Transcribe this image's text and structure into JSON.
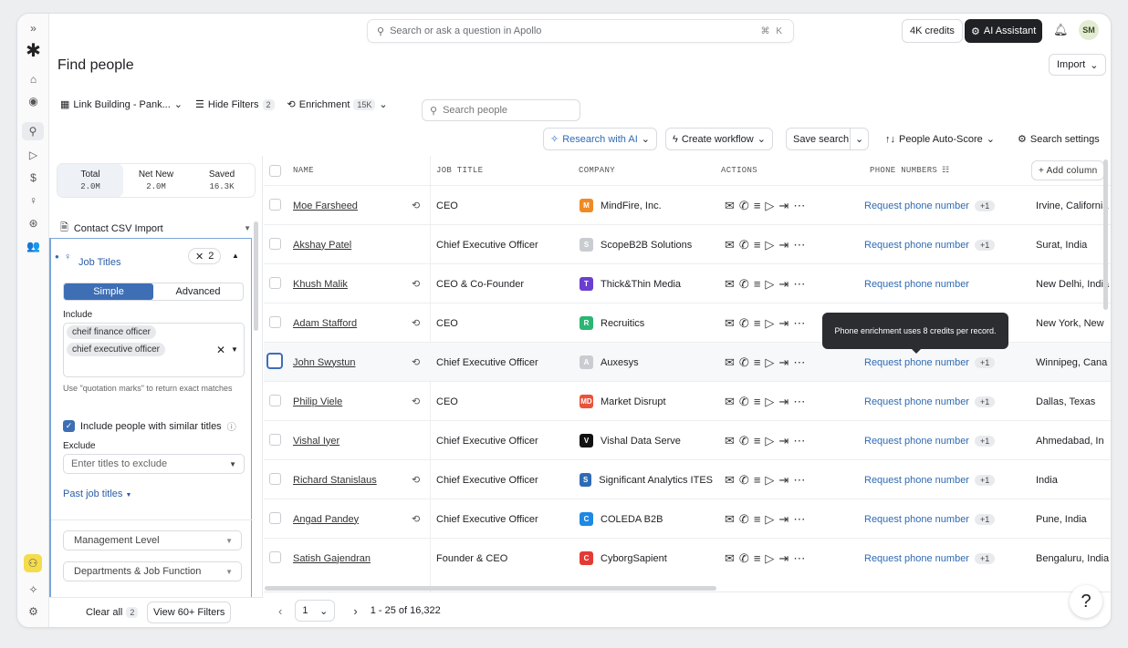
{
  "topbar": {
    "search_placeholder": "Search or ask a question in Apollo",
    "shortcut": "⌘ K",
    "credits": "4K credits",
    "ai_assistant": "AI Assistant",
    "avatar_initials": "SM"
  },
  "page": {
    "title": "Find people",
    "import_label": "Import"
  },
  "filters": {
    "list_name": "Link Building - Pank...",
    "hide_filters": "Hide Filters",
    "hide_filters_count": "2",
    "enrichment": "Enrichment",
    "enrichment_count": "15K",
    "search_placeholder": "Search people"
  },
  "toolbar": {
    "research": "Research with AI",
    "create_workflow": "Create workflow",
    "save_search": "Save search",
    "auto_score": "People Auto-Score",
    "search_settings": "Search settings"
  },
  "stats": [
    {
      "label": "Total",
      "value": "2.0M"
    },
    {
      "label": "Net New",
      "value": "2.0M"
    },
    {
      "label": "Saved",
      "value": "16.3K"
    }
  ],
  "sidebar": {
    "csv_import": "Contact CSV Import",
    "job_titles": "Job Titles",
    "job_titles_count": "2",
    "simple": "Simple",
    "advanced": "Advanced",
    "include": "Include",
    "chips": [
      "cheif finance officer",
      "chief executive officer"
    ],
    "hint": "Use \"quotation marks\" to return exact matches",
    "similar": "Include people with similar titles",
    "exclude": "Exclude",
    "exclude_placeholder": "Enter titles to exclude",
    "past_titles": "Past job titles",
    "management_level": "Management Level",
    "departments": "Departments & Job Function",
    "clear_all": "Clear all",
    "clear_count": "2",
    "view_more": "View 60+ Filters"
  },
  "table": {
    "headers": {
      "name": "NAME",
      "job_title": "JOB TITLE",
      "company": "COMPANY",
      "actions": "ACTIONS",
      "phone": "PHONE NUMBERS",
      "add_column": "+ Add column"
    },
    "rows": [
      {
        "name": "Moe Farsheed",
        "title": "CEO",
        "company": "MindFire, Inc.",
        "phone": "Request phone number",
        "plus": "+1",
        "location": "Irvine, California",
        "logo_color": "#f08a24",
        "logo": "M",
        "enriched": true
      },
      {
        "name": "Akshay Patel",
        "title": "Chief Executive Officer",
        "company": "ScopeB2B Solutions",
        "phone": "Request phone number",
        "plus": "+1",
        "location": "Surat, India",
        "logo_color": "#c9ccd1",
        "logo": "S",
        "enriched": false
      },
      {
        "name": "Khush Malik",
        "title": "CEO & Co-Founder",
        "company": "Thick&Thin Media",
        "phone": "Request phone number",
        "plus": "",
        "location": "New Delhi, India",
        "logo_color": "#6a3fd0",
        "logo": "T",
        "enriched": true
      },
      {
        "name": "Adam Stafford",
        "title": "CEO",
        "company": "Recruitics",
        "phone": "",
        "plus": "",
        "location": "New York, New",
        "logo_color": "#2bb673",
        "logo": "R",
        "enriched": true
      },
      {
        "name": "John Swystun",
        "title": "Chief Executive Officer",
        "company": "Auxesys",
        "phone": "Request phone number",
        "plus": "+1",
        "location": "Winnipeg, Cana",
        "logo_color": "#c9ccd1",
        "logo": "A",
        "enriched": true
      },
      {
        "name": "Philip Viele",
        "title": "CEO",
        "company": "Market Disrupt",
        "phone": "Request phone number",
        "plus": "+1",
        "location": "Dallas, Texas",
        "logo_color": "#e9533a",
        "logo": "MD",
        "enriched": true
      },
      {
        "name": "Vishal Iyer",
        "title": "Chief Executive Officer",
        "company": "Vishal Data Serve",
        "phone": "Request phone number",
        "plus": "+1",
        "location": "Ahmedabad, In",
        "logo_color": "#111111",
        "logo": "V",
        "enriched": false
      },
      {
        "name": "Richard Stanislaus",
        "title": "Chief Executive Officer",
        "company": "Significant Analytics ITES",
        "phone": "Request phone number",
        "plus": "+1",
        "location": "India",
        "logo_color": "#2f6bb3",
        "logo": "S",
        "enriched": true
      },
      {
        "name": "Angad Pandey",
        "title": "Chief Executive Officer",
        "company": "COLEDA B2B",
        "phone": "Request phone number",
        "plus": "+1",
        "location": "Pune, India",
        "logo_color": "#1e88e5",
        "logo": "C",
        "enriched": true
      },
      {
        "name": "Satish Gajendran",
        "title": "Founder & CEO",
        "company": "CyborgSapient",
        "phone": "Request phone number",
        "plus": "+1",
        "location": "Bengaluru, India",
        "logo_color": "#e53935",
        "logo": "C",
        "enriched": false
      }
    ],
    "tooltip": "Phone enrichment uses 8 credits per record."
  },
  "pager": {
    "page": "1",
    "range": "1 - 25 of 16,322"
  },
  "help": "?"
}
